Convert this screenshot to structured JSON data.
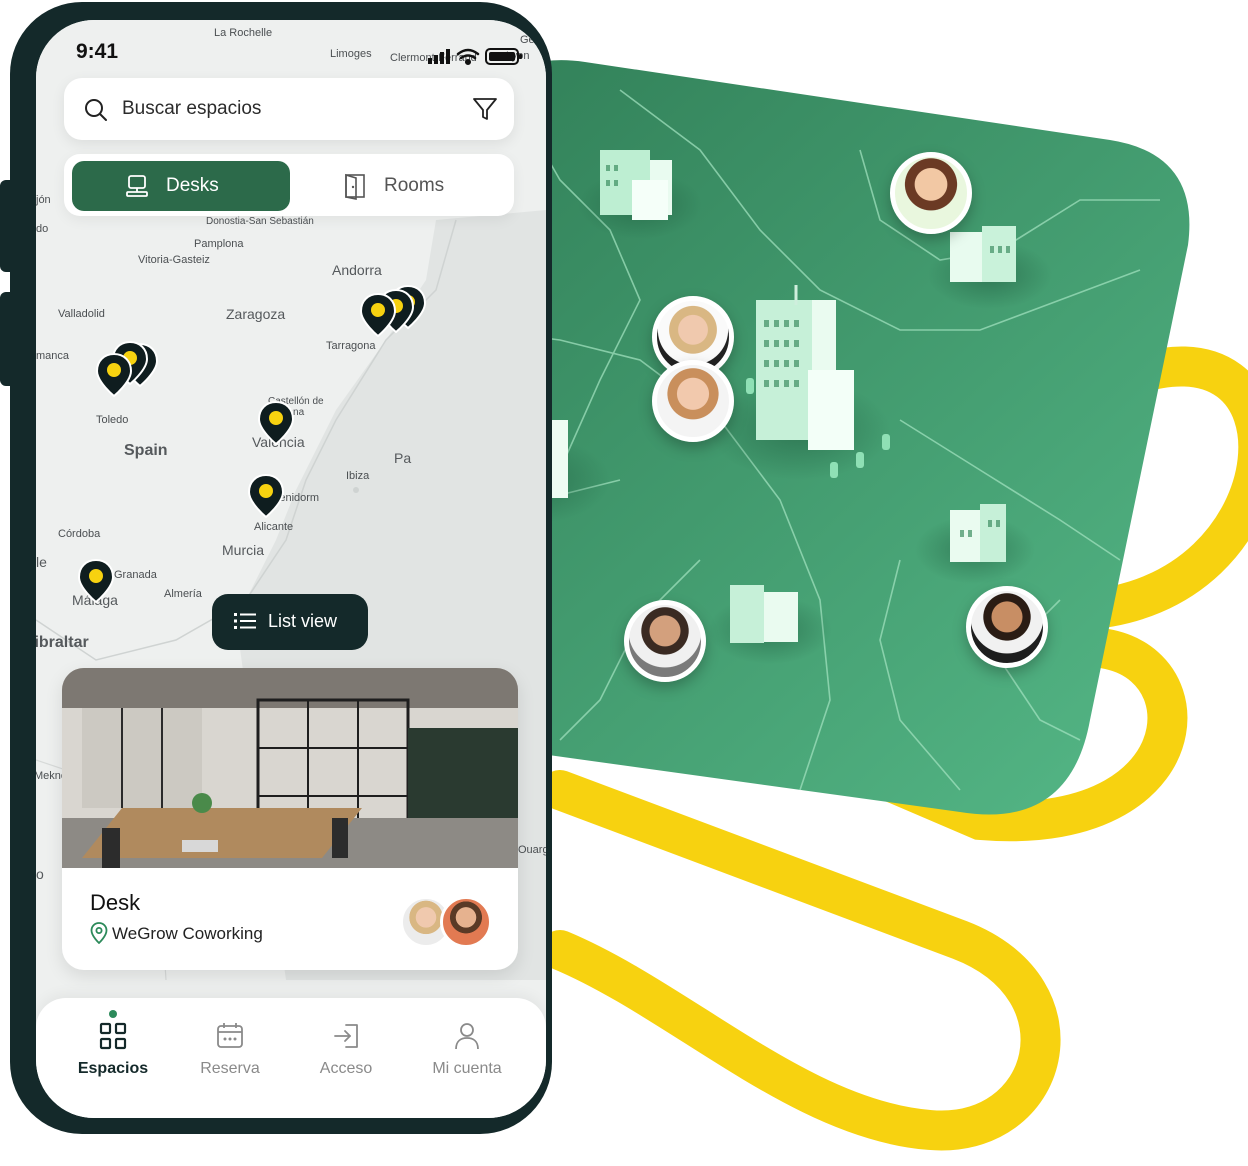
{
  "status": {
    "time": "9:41"
  },
  "search": {
    "placeholder": "Buscar espacios"
  },
  "segment": {
    "desks": "Desks",
    "rooms": "Rooms"
  },
  "map_labels": {
    "la_rochelle": "La Rochelle",
    "limoges": "Limoges",
    "clermont": "Clermont-Ferrand",
    "ge": "Ge",
    "lyon": "Lyon",
    "jon": "jón",
    "do": "do",
    "donostia": "Donostia-San Sebastián",
    "pamplona": "Pamplona",
    "vitoria": "Vitoria-Gasteiz",
    "andorra": "Andorra",
    "valladolid": "Valladolid",
    "zaragoza": "Zaragoza",
    "tarragona": "Tarragona",
    "manca": "manca",
    "toledo": "Toledo",
    "spain": "Spain",
    "castellon": "Castellón de la Plana",
    "valencia": "València",
    "pa": "Pa",
    "ibiza": "Ibiza",
    "benidorm": "Benidorm",
    "alicante": "Alicante",
    "cordoba": "Córdoba",
    "murcia": "Murcia",
    "granada": "Granada",
    "almeria": "Almería",
    "malaga": "Málaga",
    "le": "le",
    "gibraltar": "Gibraltar",
    "meknes": "Meknes",
    "o": "o",
    "ouarg": "Ouarg"
  },
  "list_view": {
    "label": "List view"
  },
  "card": {
    "title": "Desk",
    "location": "WeGrow Coworking"
  },
  "nav": {
    "items": [
      {
        "label": "Espacios",
        "icon": "grid-icon",
        "active": true
      },
      {
        "label": "Reserva",
        "icon": "calendar-icon",
        "active": false
      },
      {
        "label": "Acceso",
        "icon": "enter-icon",
        "active": false
      },
      {
        "label": "Mi cuenta",
        "icon": "user-icon",
        "active": false
      }
    ]
  },
  "colors": {
    "brand_green": "#2c6a4a",
    "dark": "#14292a",
    "map_green": "#3f9e6e",
    "accent_yellow": "#f7d210"
  }
}
